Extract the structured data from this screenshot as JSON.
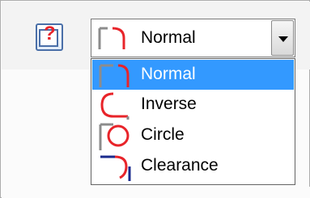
{
  "help_button": {
    "icon": "help-icon"
  },
  "combo": {
    "selected_label": "Normal",
    "selected_icon": "mark-normal-icon",
    "arrow_icon": "chevron-down-icon"
  },
  "dropdown": {
    "items": [
      {
        "label": "Normal",
        "icon": "mark-normal-icon",
        "selected": true
      },
      {
        "label": "Inverse",
        "icon": "mark-inverse-icon",
        "selected": false
      },
      {
        "label": "Circle",
        "icon": "mark-circle-icon",
        "selected": false
      },
      {
        "label": "Clearance",
        "icon": "mark-clearance-icon",
        "selected": false
      }
    ]
  },
  "colors": {
    "mark_red": "#e8242a",
    "mark_gray": "#8c8c8c",
    "mark_navy": "#1a2a8c",
    "selection": "#3399ff"
  }
}
